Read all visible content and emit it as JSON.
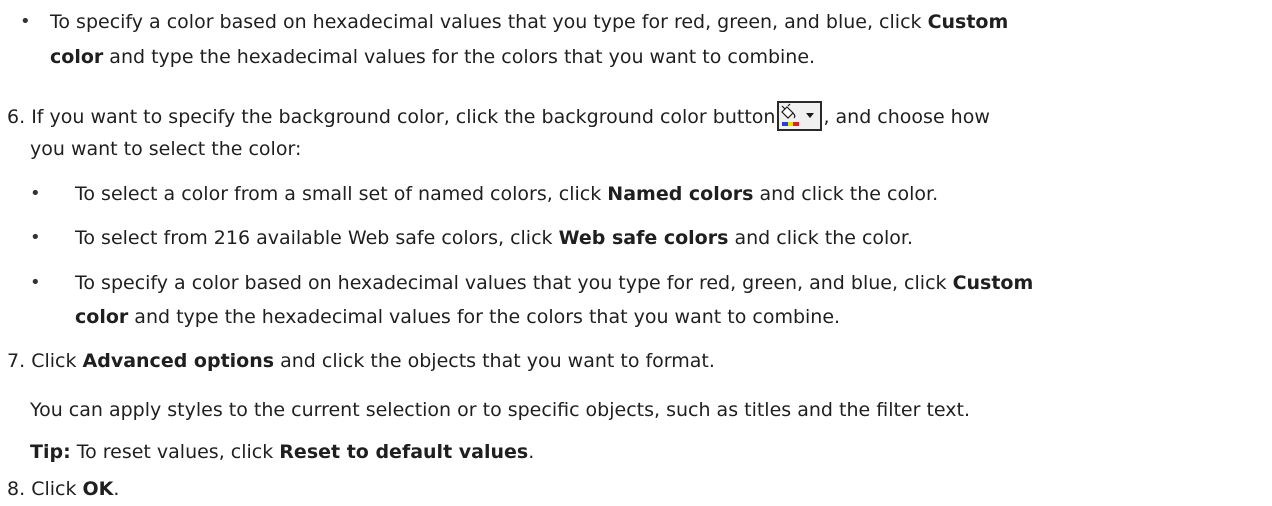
{
  "top_bullet": {
    "line1_pre": "To specify a color based on hexadecimal values that you type for red, green, and blue, click ",
    "line1_bold": "Custom",
    "line2_bold": "color",
    "line2_post": " and type the hexadecimal values for the colors that you want to combine."
  },
  "step6": {
    "number": "6.",
    "line1_pre": "If you want to specify the background color, click the background color button",
    "line1_post": ", and choose how",
    "line2": "you want to select the color:",
    "button_icon": "background-color-dropdown-icon",
    "bullets": {
      "named": {
        "pre": "To select a color from a small set of named colors, click ",
        "bold": "Named colors",
        "post": " and click the color."
      },
      "websafe": {
        "pre": "To select from 216 available Web safe colors, click ",
        "bold": "Web safe colors",
        "post": " and click the color."
      },
      "custom": {
        "line1_pre": "To specify a color based on hexadecimal values that you type for red, green, and blue, click ",
        "line1_bold": "Custom",
        "line2_bold": "color",
        "line2_post": " and type the hexadecimal values for the colors that you want to combine."
      }
    }
  },
  "step7": {
    "number": "7.",
    "pre": "Click ",
    "bold": "Advanced options",
    "post": " and click the objects that you want to format.",
    "para": "You can apply styles to the current selection or to specific objects, such as titles and the filter text.",
    "tip_label": "Tip:",
    "tip_pre": " To reset values, click ",
    "tip_bold": "Reset to default values",
    "tip_post": "."
  },
  "step8": {
    "number": "8.",
    "pre": "Click ",
    "bold": "OK",
    "post": "."
  },
  "bullet_glyph": "•"
}
